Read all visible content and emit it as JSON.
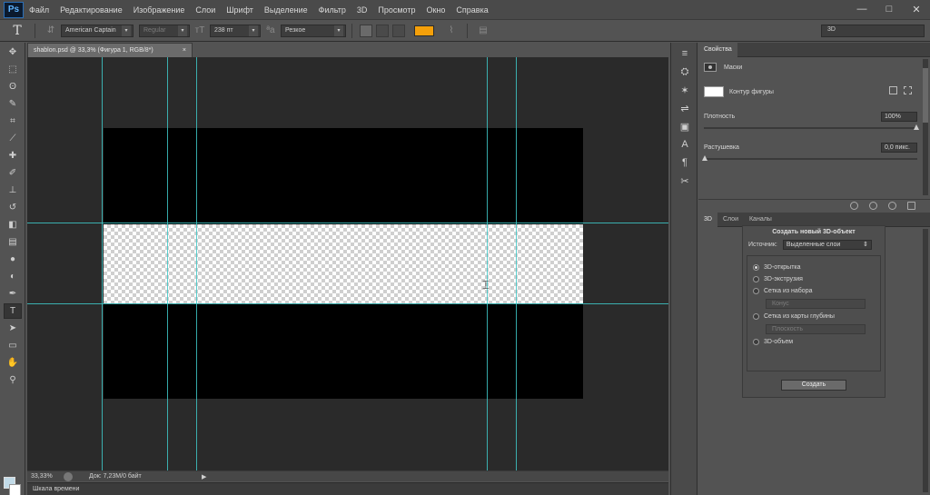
{
  "app": {
    "logo": "Ps"
  },
  "menu": [
    "Файл",
    "Редактирование",
    "Изображение",
    "Слои",
    "Шрифт",
    "Выделение",
    "Фильтр",
    "3D",
    "Просмотр",
    "Окно",
    "Справка"
  ],
  "window_controls": {
    "minimize": "—",
    "maximize": "□",
    "close": "✕"
  },
  "options": {
    "tool_glyph": "T",
    "font_family": "American Captain",
    "font_style": "Regular",
    "font_size": "238 пт",
    "antialias": "Резкое",
    "color": "#f5a00a",
    "workspace": "3D"
  },
  "document": {
    "tab_title": "shablon.psd @ 33,3% (Фигура 1, RGB/8*)",
    "tab_close": "×",
    "zoom": "33,33%",
    "doc_info": "Док: 7,23M/0 байт",
    "status_arrow": "▶",
    "timeline": "Шкала времени"
  },
  "tools": [
    "move",
    "marquee",
    "lasso",
    "quick-select",
    "crop",
    "eyedropper",
    "healing",
    "brush",
    "stamp",
    "history-brush",
    "eraser",
    "gradient",
    "blur",
    "dodge",
    "pen",
    "type",
    "path-select",
    "shape",
    "hand",
    "zoom"
  ],
  "tool_glyphs": [
    "✥",
    "⬚",
    "ʘ",
    "✎",
    "⌗",
    "⟋",
    "✚",
    "✐",
    "⊥",
    "↺",
    "◧",
    "▤",
    "●",
    "◐",
    "✒",
    "T",
    "➤",
    "▭",
    "✋",
    "⚲"
  ],
  "strip_icons": [
    "≡",
    "⛭",
    "✶",
    "⇌",
    "▣",
    "A",
    "¶",
    "✂"
  ],
  "properties": {
    "tab": "Свойства",
    "masks_label": "Маски",
    "shape_label": "Контур фигуры",
    "density_label": "Плотность",
    "density_value": "100%",
    "feather_label": "Растушевка",
    "feather_value": "0,0 пикс."
  },
  "layers_panel": {
    "tabs": [
      "3D",
      "Слои",
      "Каналы"
    ],
    "dialog_title": "Создать новый 3D-объект",
    "source_label": "Источник:",
    "source_value": "Выделенные слои",
    "options": [
      {
        "label": "3D-открытка",
        "selected": true
      },
      {
        "label": "3D-экструзия",
        "selected": false
      },
      {
        "label": "Сетка из набора",
        "selected": false
      },
      {
        "label": "Сетка из карты глубины",
        "selected": false
      },
      {
        "label": "3D-объем",
        "selected": false
      }
    ],
    "preset_value": "Конус",
    "depth_value": "Плоскость",
    "create_button": "Создать"
  }
}
